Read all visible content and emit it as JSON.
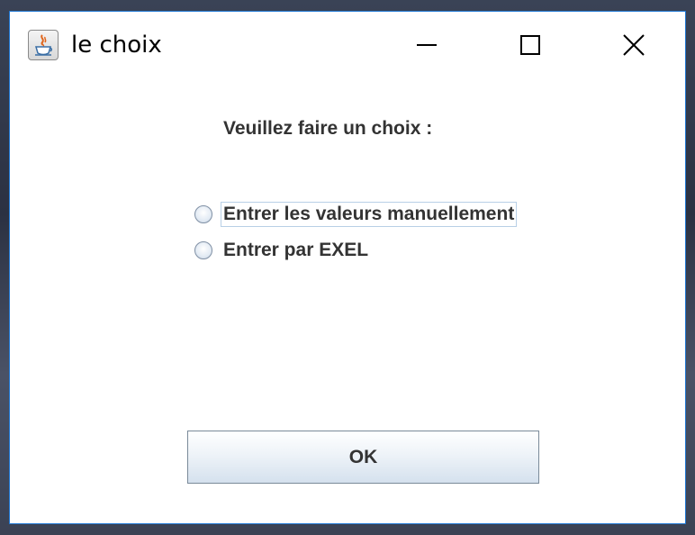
{
  "window": {
    "title": "le choix",
    "app_icon": "java-cup-icon",
    "controls": [
      "minimize-icon",
      "maximize-icon",
      "close-icon"
    ]
  },
  "dialog": {
    "prompt": "Veuillez faire un choix :",
    "options": [
      {
        "label": "Entrer les valeurs manuellement",
        "selected": false,
        "focused": true
      },
      {
        "label": "Entrer par EXEL",
        "selected": false,
        "focused": false
      }
    ],
    "ok_label": "OK"
  },
  "colors": {
    "window_border": "#1e76d2",
    "text": "#333333"
  }
}
